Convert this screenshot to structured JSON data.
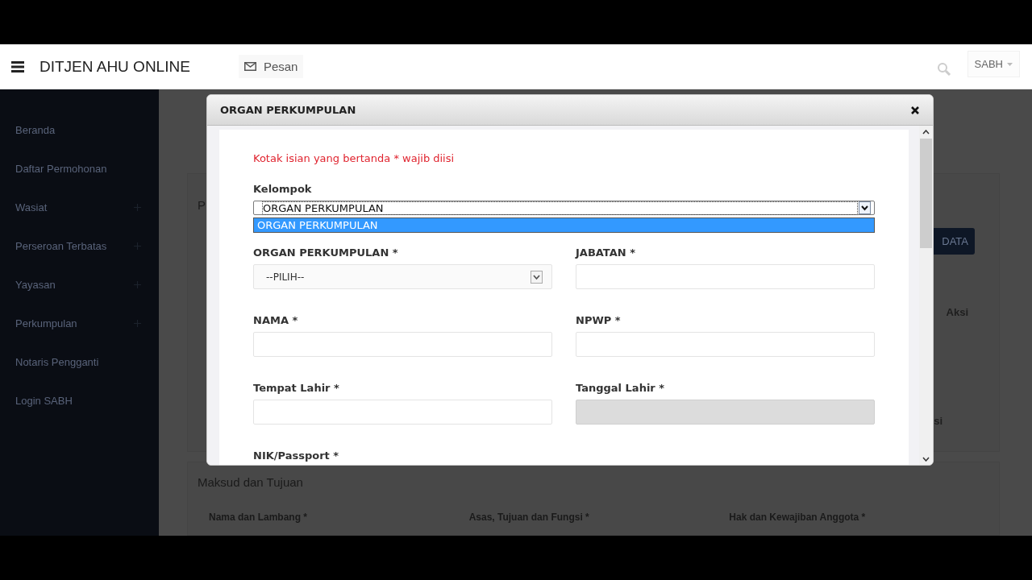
{
  "header": {
    "title": "DITJEN AHU ONLINE",
    "messages_button": "Pesan",
    "user_menu": "SABH"
  },
  "sidebar": {
    "items": [
      {
        "label": "Beranda",
        "expandable": false
      },
      {
        "label": "Daftar Permohonan",
        "expandable": false
      },
      {
        "label": "Wasiat",
        "expandable": true
      },
      {
        "label": "Perseroan Terbatas",
        "expandable": true
      },
      {
        "label": "Yayasan",
        "expandable": true
      },
      {
        "label": "Perkumpulan",
        "expandable": true
      },
      {
        "label": "Notaris Pengganti",
        "expandable": false
      },
      {
        "label": "Login SABH",
        "expandable": false
      }
    ]
  },
  "background": {
    "heading_fragment": "P",
    "button_fragment": "DATA",
    "column_header": "Aksi",
    "cell_fragment": "si",
    "section_title": "Maksud dan Tujuan",
    "section_fields": [
      "Nama dan Lambang *",
      "Asas, Tujuan dan Fungsi *",
      "Hak dan Kewajiban Anggota *"
    ]
  },
  "modal": {
    "title": "ORGAN PERKUMPULAN",
    "notice": "Kotak isian yang bertanda * wajib diisi",
    "group": {
      "label": "Kelompok",
      "value": "ORGAN PERKUMPULAN",
      "options": [
        {
          "label": "ORGAN PERKUMPULAN",
          "selected": true
        }
      ]
    },
    "fields": [
      {
        "label": "ORGAN PERKUMPULAN *",
        "kind": "select",
        "value": "--PILIH--",
        "disabled": false
      },
      {
        "label": "JABATAN *",
        "kind": "text",
        "disabled": false
      },
      {
        "label": "NAMA *",
        "kind": "text",
        "disabled": false
      },
      {
        "label": "NPWP *",
        "kind": "text",
        "disabled": false
      },
      {
        "label": "Tempat Lahir *",
        "kind": "text",
        "disabled": false
      },
      {
        "label": "Tanggal Lahir *",
        "kind": "text",
        "disabled": true
      },
      {
        "label": "NIK/Passport *"
      }
    ]
  }
}
